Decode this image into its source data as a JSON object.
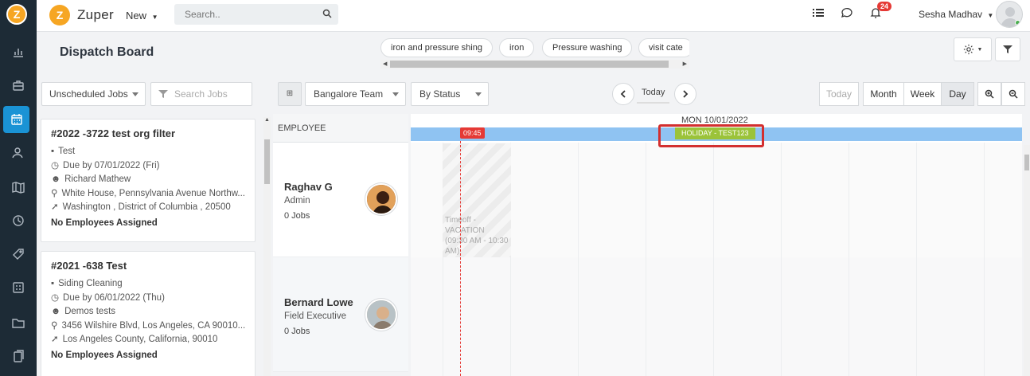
{
  "app": {
    "brand": "Zuper",
    "new_label": "New"
  },
  "search": {
    "placeholder": "Search.."
  },
  "notifications": {
    "count": "24"
  },
  "user": {
    "name": "Sesha Madhav"
  },
  "page": {
    "title": "Dispatch Board"
  },
  "filter_chips": [
    "iron and pressure shing",
    "iron",
    "Pressure washing",
    "visit cate"
  ],
  "toolbar": {
    "job_filter": "Unscheduled Jobs",
    "search_jobs_placeholder": "Search Jobs",
    "team": "Bangalore Team",
    "group_by": "By Status",
    "today_center": "Today",
    "view_today": "Today",
    "view_month": "Month",
    "view_week": "Week",
    "view_day": "Day"
  },
  "jobs": [
    {
      "title": "#2022 -3722 test org filter",
      "category": "Test",
      "due": "Due by 07/01/2022 (Fri)",
      "customer": "Richard Mathew",
      "address1": "White House, Pennsylvania Avenue Northw...",
      "address2": "Washington , District of Columbia , 20500",
      "assignment": "No Employees Assigned"
    },
    {
      "title": "#2021 -638 Test",
      "category": "Siding Cleaning",
      "due": "Due by 06/01/2022 (Thu)",
      "customer": "Demos tests",
      "address1": "3456 Wilshire Blvd, Los Angeles, CA 90010...",
      "address2": "Los Angeles County, California, 90010",
      "assignment": "No Employees Assigned"
    }
  ],
  "employee_header": "EMPLOYEE",
  "employees": [
    {
      "name": "Raghav G",
      "role": "Admin",
      "jobs": "0 Jobs"
    },
    {
      "name": "Bernard Lowe",
      "role": "Field Executive",
      "jobs": "0 Jobs"
    }
  ],
  "timeline": {
    "date": "MON 10/01/2022",
    "now": "09:45",
    "holiday": "HOLIDAY - TEST123",
    "timeoff": "Timeoff - VACATION (09:30 AM - 10:30 AM)"
  },
  "colors": {
    "sidebar": "#1d2b36",
    "active": "#1a93d5",
    "holiday_band": "#8fc3f2",
    "holiday_tag": "#9bc33a",
    "now_marker": "#e53935",
    "highlight_box": "#d32f2f"
  }
}
